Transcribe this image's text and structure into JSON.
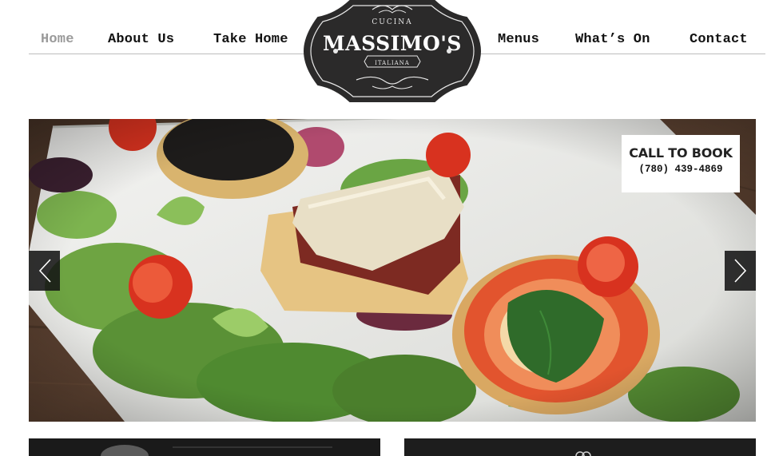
{
  "nav": {
    "items": [
      {
        "label": "Home",
        "active": true
      },
      {
        "label": "About Us",
        "active": false
      },
      {
        "label": "Take Home",
        "active": false
      },
      {
        "label": "Menus",
        "active": false
      },
      {
        "label": "What’s On",
        "active": false
      },
      {
        "label": "Contact",
        "active": false
      }
    ]
  },
  "logo": {
    "top_text": "CUCINA",
    "name": "MASSIMO'S",
    "bottom_text": "ITALIANA"
  },
  "hero": {
    "book_title": "CALL TO BOOK",
    "book_phone": "(780) 439-4869",
    "prev_icon": "chevron-left-icon",
    "next_icon": "chevron-right-icon"
  },
  "colors": {
    "nav_text": "#111111",
    "nav_active": "#9a9a9a",
    "logo_bg": "#2b2a2a",
    "arrow_bg": "#141414"
  }
}
